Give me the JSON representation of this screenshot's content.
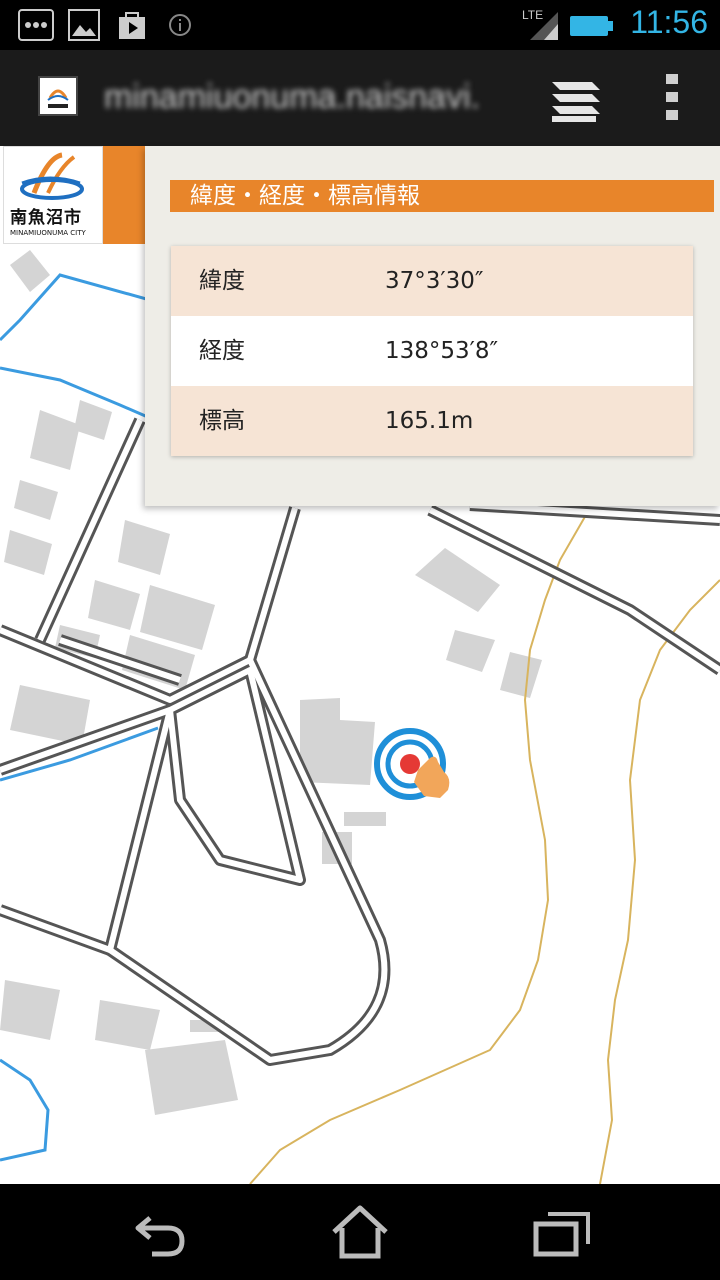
{
  "status_bar": {
    "time": "11:56",
    "network": "LTE",
    "icons": [
      "more-icon",
      "image-icon",
      "play-store-icon",
      "info-icon",
      "signal-icon",
      "battery-icon"
    ]
  },
  "browser": {
    "url": "minamiuonuma.naisnavi.",
    "icons": [
      "favicon",
      "tabs-icon",
      "overflow-menu-icon"
    ]
  },
  "logo": {
    "name": "南魚沼市",
    "subtitle": "MINAMIUONUMA CITY"
  },
  "panel": {
    "title": "緯度・経度・標高情報",
    "rows": [
      {
        "label": "緯度",
        "value": "37°3′30″"
      },
      {
        "label": "経度",
        "value": "138°53′8″"
      },
      {
        "label": "標高",
        "value": "165.1m"
      }
    ]
  },
  "nav": {
    "icons": [
      "back-icon",
      "home-icon",
      "recent-apps-icon"
    ]
  },
  "colors": {
    "accent": "#e8852a",
    "status_time": "#33b5e5",
    "row_alt": "#f6e4d5",
    "panel_bg": "#eeede7"
  }
}
